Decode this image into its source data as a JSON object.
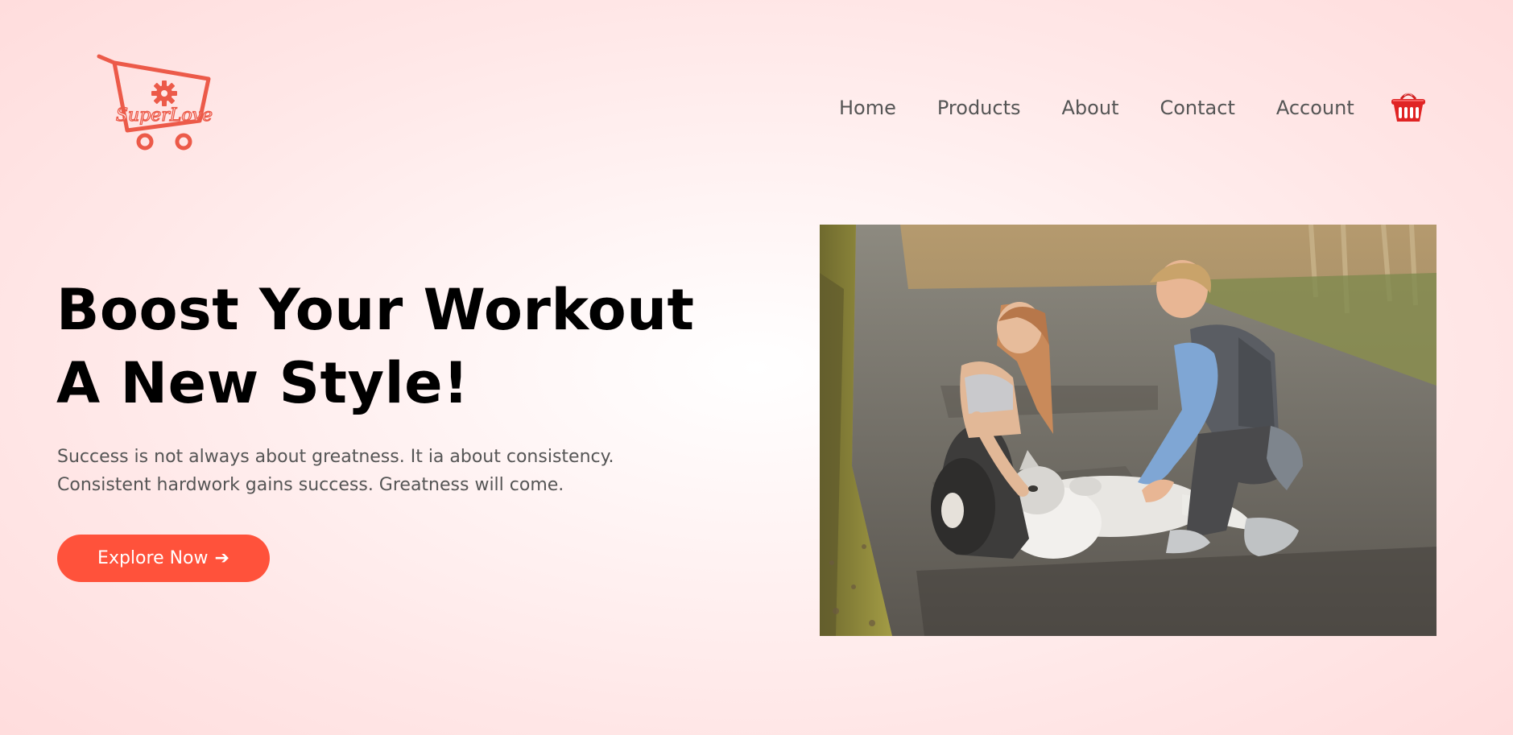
{
  "brand": {
    "logo_text": "SuperLove",
    "accent_color": "#ff523b"
  },
  "nav": {
    "items": [
      {
        "label": "Home"
      },
      {
        "label": "Products"
      },
      {
        "label": "About"
      },
      {
        "label": "Contact"
      },
      {
        "label": "Account"
      }
    ],
    "cart_icon": "basket-icon"
  },
  "hero": {
    "title_line1": "Boost Your Workout",
    "title_line2": "A New Style!",
    "text_line1": "Success is not always about greatness. It ia about consistency.",
    "text_line2": "Consistent hardwork gains success. Greatness will come.",
    "cta_label": "Explore Now",
    "cta_arrow": "➔",
    "image_icon": "photo-couple-with-dog"
  }
}
